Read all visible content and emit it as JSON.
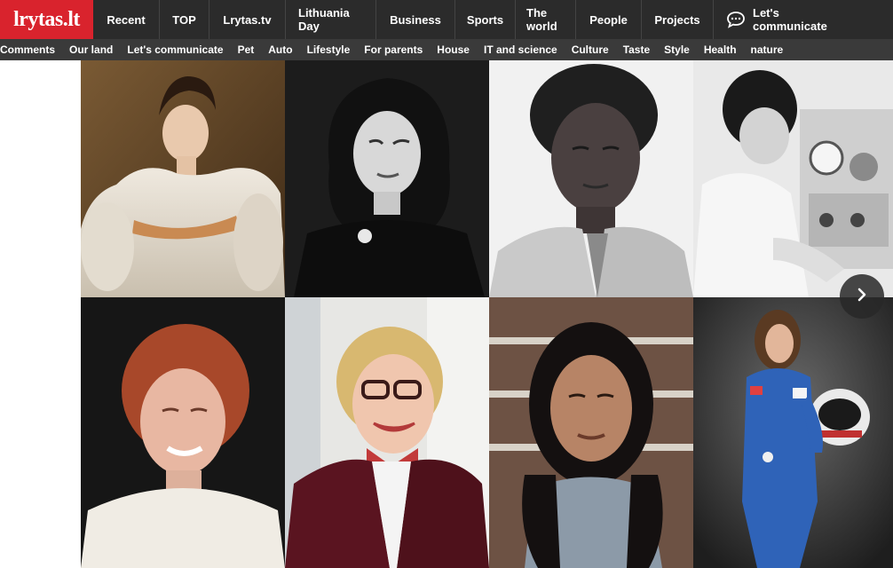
{
  "header": {
    "logo_text": "lrytas.lt",
    "nav": [
      {
        "label": "Recent"
      },
      {
        "label": "TOP"
      },
      {
        "label": "Lrytas.tv"
      },
      {
        "label": "Lithuania Day"
      },
      {
        "label": "Business"
      },
      {
        "label": "Sports"
      },
      {
        "label": "The world"
      },
      {
        "label": "People"
      },
      {
        "label": "Projects"
      },
      {
        "label": "Let's communicate",
        "icon": "chat-bubble-icon"
      }
    ]
  },
  "subnav": {
    "items": [
      "Comments",
      "Our land",
      "Let's communicate",
      "Pet",
      "Auto",
      "Lifestyle",
      "For parents",
      "House",
      "IT and science",
      "Culture",
      "Taste",
      "Style",
      "Health",
      "nature"
    ]
  },
  "gallery": {
    "next_icon": "chevron-right-icon",
    "colors": {
      "brand": "#d9232d",
      "topbar": "#2b2b2b",
      "subbar": "#3a3a3a"
    }
  }
}
